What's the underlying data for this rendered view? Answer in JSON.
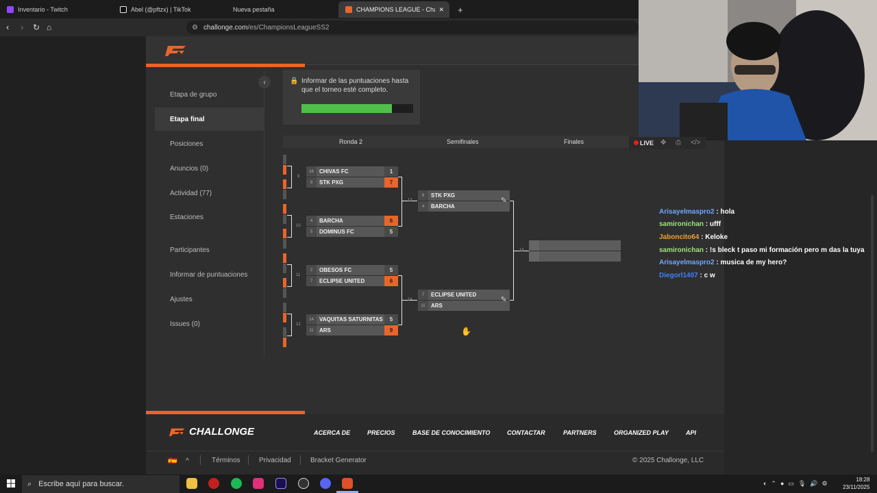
{
  "browser": {
    "tabs": [
      {
        "label": "Inventario - Twitch",
        "icon_color": "#9146ff",
        "active": false
      },
      {
        "label": "Abel (@pftzx) | TikTok",
        "icon_color": "#ffffff",
        "active": false
      },
      {
        "label": "Nueva pestaña",
        "icon_color": "",
        "active": false
      },
      {
        "label": "CHAMPIONS LEAGUE - Challonge",
        "icon_color": "#e8652b",
        "active": true
      }
    ],
    "tab_close": "✕",
    "new_tab": "+",
    "url_host": "challonge.com",
    "url_path": "/es/ChampionsLeagueSS2"
  },
  "sidebar": {
    "items": [
      {
        "label": "Etapa de grupo"
      },
      {
        "label": "Etapa final"
      },
      {
        "label": "Posiciones"
      },
      {
        "label": "Anuncios (0)"
      },
      {
        "label": "Actividad (77)"
      },
      {
        "label": "Estaciones"
      },
      {
        "label": "Participantes"
      },
      {
        "label": "Informar de puntuaciones"
      },
      {
        "label": "Ajustes"
      },
      {
        "label": "Issues (0)"
      }
    ],
    "active_index": 1
  },
  "notice": {
    "text": "Informar de las puntuaciones hasta que el torneo esté completo.",
    "progress": 0.81
  },
  "rounds": [
    "Ronda 2",
    "Semifinales",
    "Finales"
  ],
  "matches": [
    {
      "num": "9",
      "top": {
        "seed": "16",
        "name": "CHIVAS FC",
        "score": "1",
        "win": false
      },
      "bottom": {
        "seed": "8",
        "name": "STK PXG",
        "score": "7",
        "win": true
      }
    },
    {
      "num": "10",
      "top": {
        "seed": "4",
        "name": "BARCHA",
        "score": "6",
        "win": true
      },
      "bottom": {
        "seed": "5",
        "name": "DOMINUS FC",
        "score": "5",
        "win": false
      }
    },
    {
      "num": "11",
      "top": {
        "seed": "2",
        "name": "OBESOS FC",
        "score": "5",
        "win": false
      },
      "bottom": {
        "seed": "7",
        "name": "ECLIPSE UNITED",
        "score": "6",
        "win": true
      }
    },
    {
      "num": "12",
      "top": {
        "seed": "14",
        "name": "VAQUITAS SATURNITAS",
        "score": "5",
        "win": false
      },
      "bottom": {
        "seed": "11",
        "name": "ARS",
        "score": "9",
        "win": true
      }
    },
    {
      "num": "13",
      "top": {
        "seed": "8",
        "name": "STK PXG",
        "score": "",
        "win": false
      },
      "bottom": {
        "seed": "4",
        "name": "BARCHA",
        "score": "",
        "win": false
      }
    },
    {
      "num": "14",
      "top": {
        "seed": "7",
        "name": "ECLIPSE UNITED",
        "score": "",
        "win": false
      },
      "bottom": {
        "seed": "11",
        "name": "ARS",
        "score": "",
        "win": false
      }
    },
    {
      "num": "15",
      "top": {
        "seed": "",
        "name": "",
        "score": "",
        "win": false
      },
      "bottom": {
        "seed": "",
        "name": "",
        "score": "",
        "win": false
      }
    }
  ],
  "footer": {
    "logo": "CHALLONGE",
    "links": [
      "ACERCA DE",
      "PRECIOS",
      "BASE DE CONOCIMIENTO",
      "CONTACTAR",
      "PARTNERS",
      "ORGANIZED PLAY",
      "API"
    ],
    "flag": "🇪🇸",
    "caret": "^",
    "bottom_links": [
      "Términos",
      "Privacidad",
      "Bracket Generator"
    ],
    "copyright": "© 2025 Challonge, LLC"
  },
  "stream": {
    "live_label": "LIVE",
    "chat": [
      {
        "user": "Arisayelmaspro2",
        "color": "#6fa8ff",
        "text": "hola"
      },
      {
        "user": "samironichan",
        "color": "#9be37d",
        "text": "ufff"
      },
      {
        "user": "Jaboncito64",
        "color": "#f0a030",
        "text": "Keloke"
      },
      {
        "user": "samironichan",
        "color": "#9be37d",
        "text": "!s bleck t paso mi formación pero m das la tuya"
      },
      {
        "user": "Arisayelmaspro2",
        "color": "#6fa8ff",
        "text": "musica de my hero?"
      },
      {
        "user": "Diegorl1407",
        "color": "#3f7fff",
        "text": "c w"
      }
    ]
  },
  "taskbar": {
    "search_placeholder": "Escribe aquí para buscar.",
    "time": "18:28",
    "date": "23/11/2025"
  }
}
